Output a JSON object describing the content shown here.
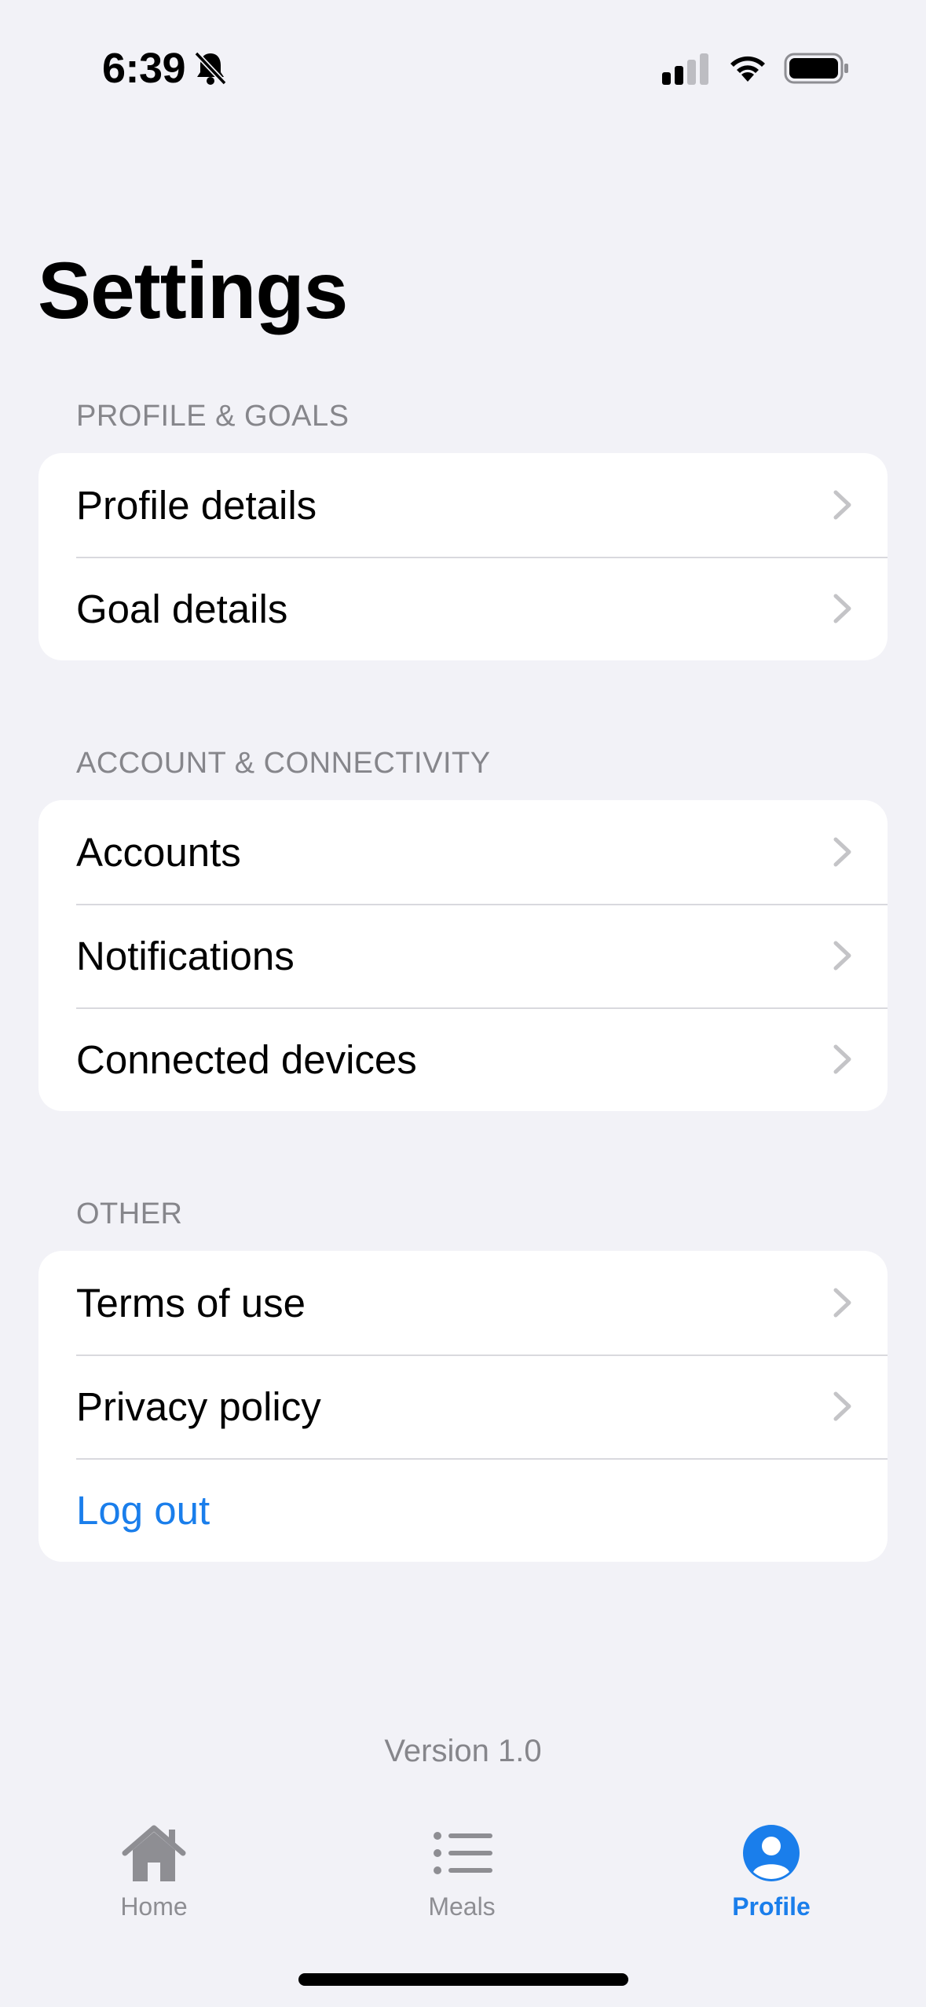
{
  "status_bar": {
    "time": "6:39"
  },
  "page": {
    "title": "Settings"
  },
  "sections": [
    {
      "header": "PROFILE & GOALS",
      "items": [
        {
          "label": "Profile details"
        },
        {
          "label": "Goal details"
        }
      ]
    },
    {
      "header": "ACCOUNT & CONNECTIVITY",
      "items": [
        {
          "label": "Accounts"
        },
        {
          "label": "Notifications"
        },
        {
          "label": "Connected devices"
        }
      ]
    },
    {
      "header": "OTHER",
      "items": [
        {
          "label": "Terms of use"
        },
        {
          "label": "Privacy policy"
        },
        {
          "label": "Log out"
        }
      ]
    }
  ],
  "footer": {
    "version": "Version 1.0"
  },
  "tab_bar": {
    "tabs": [
      {
        "label": "Home",
        "icon": "house-icon"
      },
      {
        "label": "Meals",
        "icon": "list-icon"
      },
      {
        "label": "Profile",
        "icon": "person-circle-icon",
        "active": true
      }
    ]
  },
  "colors": {
    "accent": "#1A7EEB",
    "background": "#F2F2F7",
    "secondary_text": "#86868B",
    "chevron": "#C4C4C7"
  }
}
